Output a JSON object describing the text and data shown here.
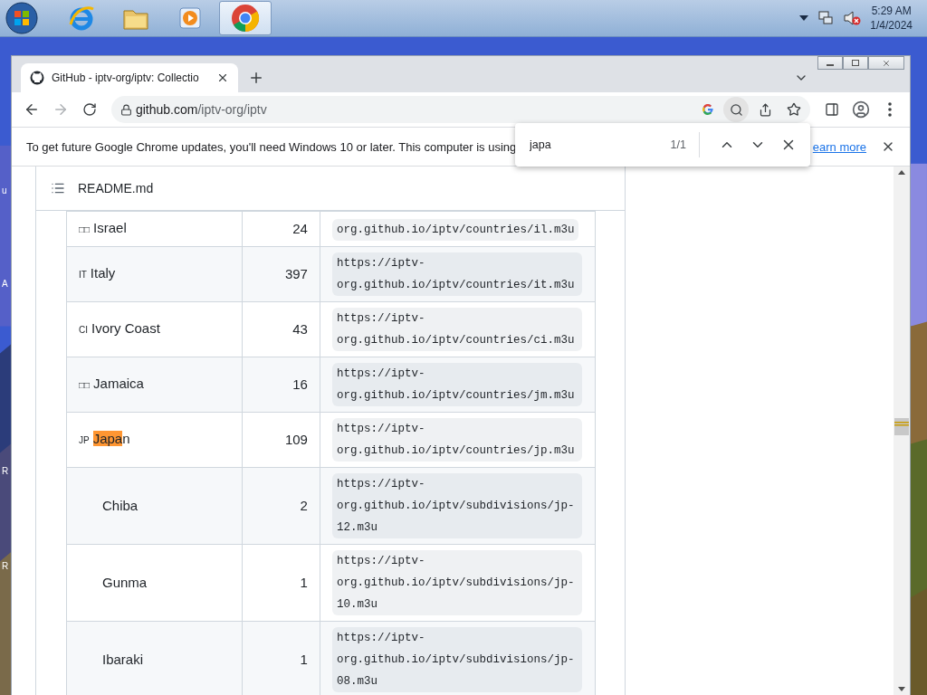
{
  "taskbar": {
    "apps": [
      {
        "kind": "start",
        "selected": false
      },
      {
        "kind": "ie",
        "selected": false
      },
      {
        "kind": "folder",
        "selected": false
      },
      {
        "kind": "media",
        "selected": false
      },
      {
        "kind": "chrome",
        "selected": true
      }
    ],
    "time": "5:29 AM",
    "date": "1/4/2024"
  },
  "desktop": {
    "labels": [
      "u",
      "A",
      "R",
      "R"
    ]
  },
  "browser": {
    "tab": {
      "title": "GitHub - iptv-org/iptv: Collectio"
    },
    "url": {
      "host": "github.com",
      "path": "/iptv-org/iptv"
    },
    "infobar": {
      "message": "To get future Google Chrome updates, you'll need Windows 10 or later. This computer is using",
      "link": "earn more"
    },
    "find": {
      "value": "japa",
      "count": "1/1"
    }
  },
  "readme": {
    "title": "README.md"
  },
  "table": {
    "rows": [
      {
        "flag": "□□",
        "name": [
          {
            "text": "Israel",
            "highlighted": false
          }
        ],
        "count": "24",
        "url": "org.github.io/iptv/countries/il.m3u"
      },
      {
        "flag": "IT",
        "name": [
          {
            "text": "Italy",
            "highlighted": false
          }
        ],
        "count": "397",
        "url": "https://iptv-org.github.io/iptv/countries/it.m3u"
      },
      {
        "flag": "CI",
        "name": [
          {
            "text": "Ivory Coast",
            "highlighted": false
          }
        ],
        "count": "43",
        "url": "https://iptv-org.github.io/iptv/countries/ci.m3u"
      },
      {
        "flag": "□□",
        "name": [
          {
            "text": "Jamaica",
            "highlighted": false
          }
        ],
        "count": "16",
        "url": "https://iptv-org.github.io/iptv/countries/jm.m3u"
      },
      {
        "flag": "JP",
        "name": [
          {
            "text": "Japa",
            "highlighted": true
          },
          {
            "text": "n",
            "highlighted": false
          }
        ],
        "count": "109",
        "url": "https://iptv-org.github.io/iptv/countries/jp.m3u",
        "children": [
          {
            "name": [
              {
                "text": "Chiba",
                "highlighted": false
              }
            ],
            "count": "2",
            "url": "https://iptv-org.github.io/iptv/subdivisions/jp-12.m3u"
          },
          {
            "name": [
              {
                "text": "Gunma",
                "highlighted": false
              }
            ],
            "count": "1",
            "url": "https://iptv-org.github.io/iptv/subdivisions/jp-10.m3u"
          },
          {
            "name": [
              {
                "text": "Ibaraki",
                "highlighted": false
              }
            ],
            "count": "1",
            "url": "https://iptv-org.github.io/iptv/subdivisions/jp-08.m3u"
          }
        ]
      }
    ]
  }
}
